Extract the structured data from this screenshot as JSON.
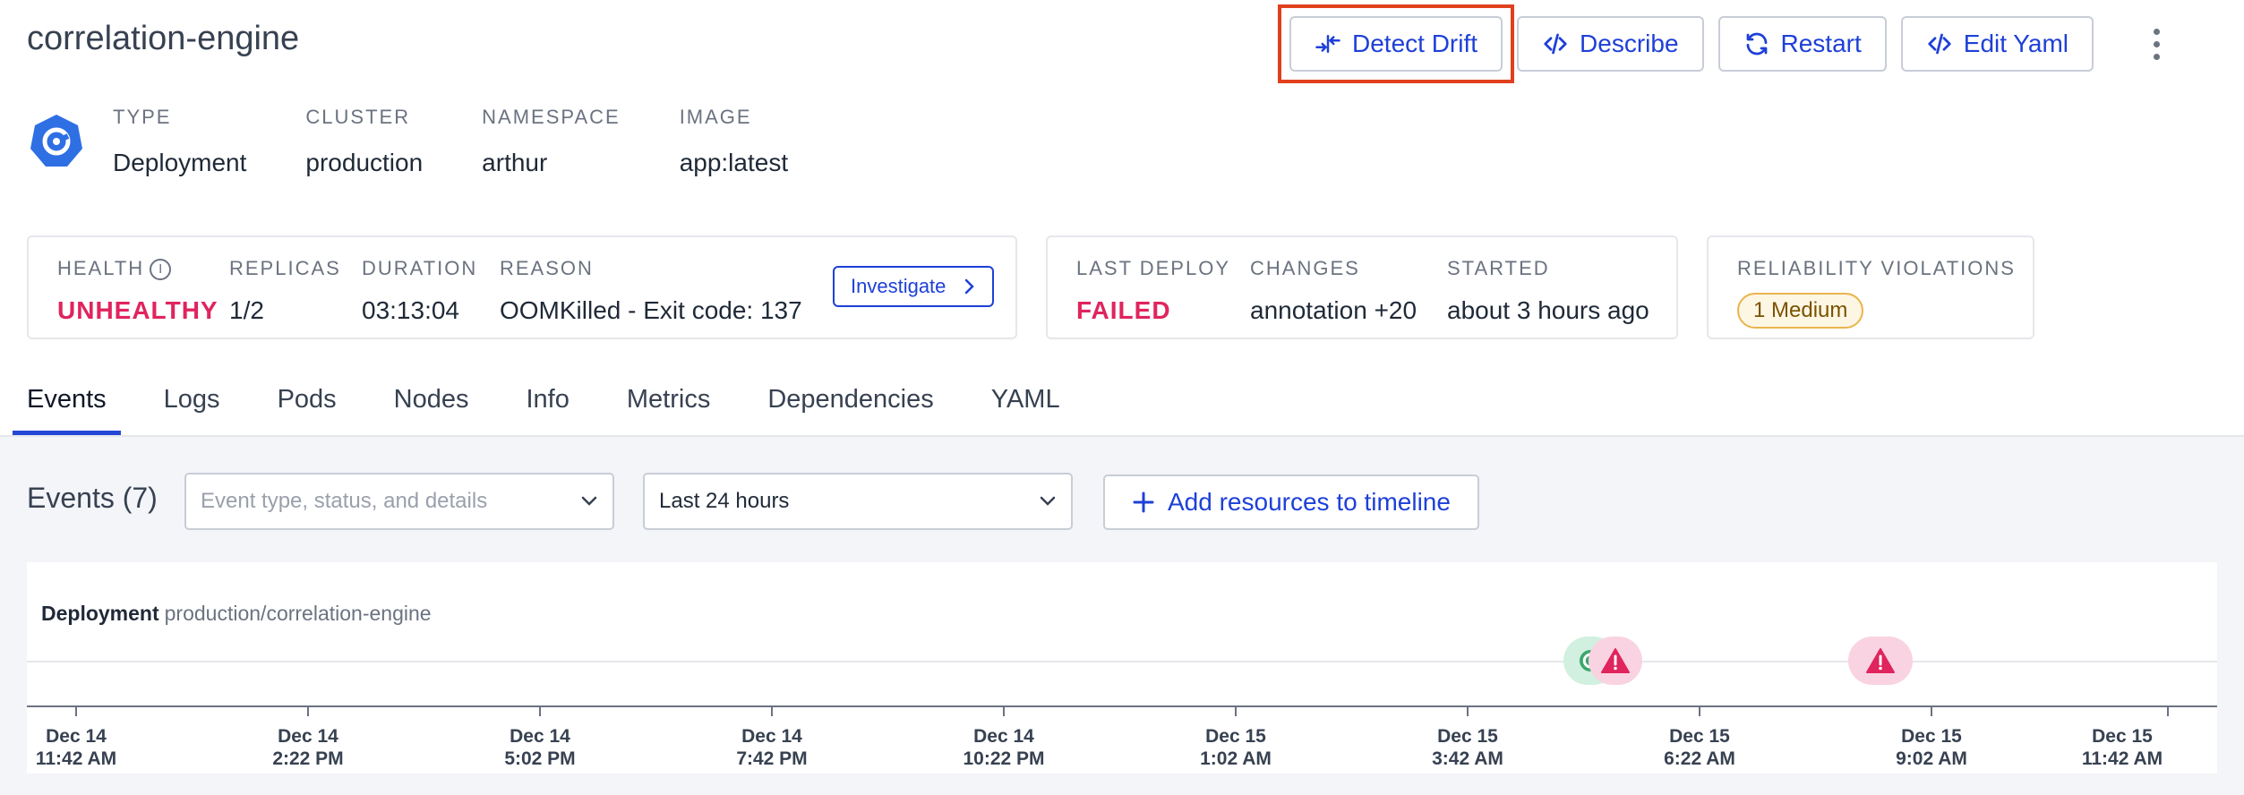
{
  "header": {
    "title": "correlation-engine",
    "actions": {
      "detect_drift": "Detect Drift",
      "describe": "Describe",
      "restart": "Restart",
      "edit_yaml": "Edit Yaml"
    }
  },
  "meta": {
    "type_label": "TYPE",
    "type_value": "Deployment",
    "cluster_label": "CLUSTER",
    "cluster_value": "production",
    "namespace_label": "NAMESPACE",
    "namespace_value": "arthur",
    "image_label": "IMAGE",
    "image_value": "app:latest"
  },
  "health_card": {
    "health_label": "HEALTH",
    "health_value": "UNHEALTHY",
    "replicas_label": "REPLICAS",
    "replicas_value": "1/2",
    "duration_label": "DURATION",
    "duration_value": "03:13:04",
    "reason_label": "REASON",
    "reason_value": "OOMKilled - Exit code: 137",
    "investigate": "Investigate"
  },
  "deploy_card": {
    "last_deploy_label": "LAST DEPLOY",
    "last_deploy_value": "FAILED",
    "changes_label": "CHANGES",
    "changes_value": "annotation +20",
    "started_label": "STARTED",
    "started_value": "about 3 hours ago"
  },
  "violations_card": {
    "label": "RELIABILITY VIOLATIONS",
    "badge": "1 Medium"
  },
  "tabs": [
    "Events",
    "Logs",
    "Pods",
    "Nodes",
    "Info",
    "Metrics",
    "Dependencies",
    "YAML"
  ],
  "events": {
    "title": "Events (7)",
    "filter_placeholder": "Event type, status, and details",
    "time_range": "Last 24 hours",
    "add_resources": "Add resources to timeline"
  },
  "timeline": {
    "resource_kind": "Deployment",
    "resource_path": "production/correlation-engine",
    "ticks": [
      {
        "date": "Dec 14",
        "time": "11:42 AM"
      },
      {
        "date": "Dec 14",
        "time": "2:22 PM"
      },
      {
        "date": "Dec 14",
        "time": "5:02 PM"
      },
      {
        "date": "Dec 14",
        "time": "7:42 PM"
      },
      {
        "date": "Dec 14",
        "time": "10:22 PM"
      },
      {
        "date": "Dec 15",
        "time": "1:02 AM"
      },
      {
        "date": "Dec 15",
        "time": "3:42 AM"
      },
      {
        "date": "Dec 15",
        "time": "6:22 AM"
      },
      {
        "date": "Dec 15",
        "time": "9:02 AM"
      },
      {
        "date": "Dec 15",
        "time": "11:42 AM"
      }
    ],
    "markers": [
      {
        "type": "deploy",
        "time": "Dec 15 5:07 AM",
        "color": "#d1f0df",
        "icon_color": "#3aa76d"
      },
      {
        "type": "warning",
        "time": "Dec 15 5:14 AM",
        "color": "#f9d3e1",
        "icon_color": "#e0245e"
      },
      {
        "type": "warning",
        "time": "Dec 15 8:19 AM",
        "color": "#f9d3e1",
        "icon_color": "#e0245e"
      }
    ]
  },
  "colors": {
    "accent": "#1e40d8",
    "danger": "#e0245e",
    "highlight": "#e0401e"
  }
}
